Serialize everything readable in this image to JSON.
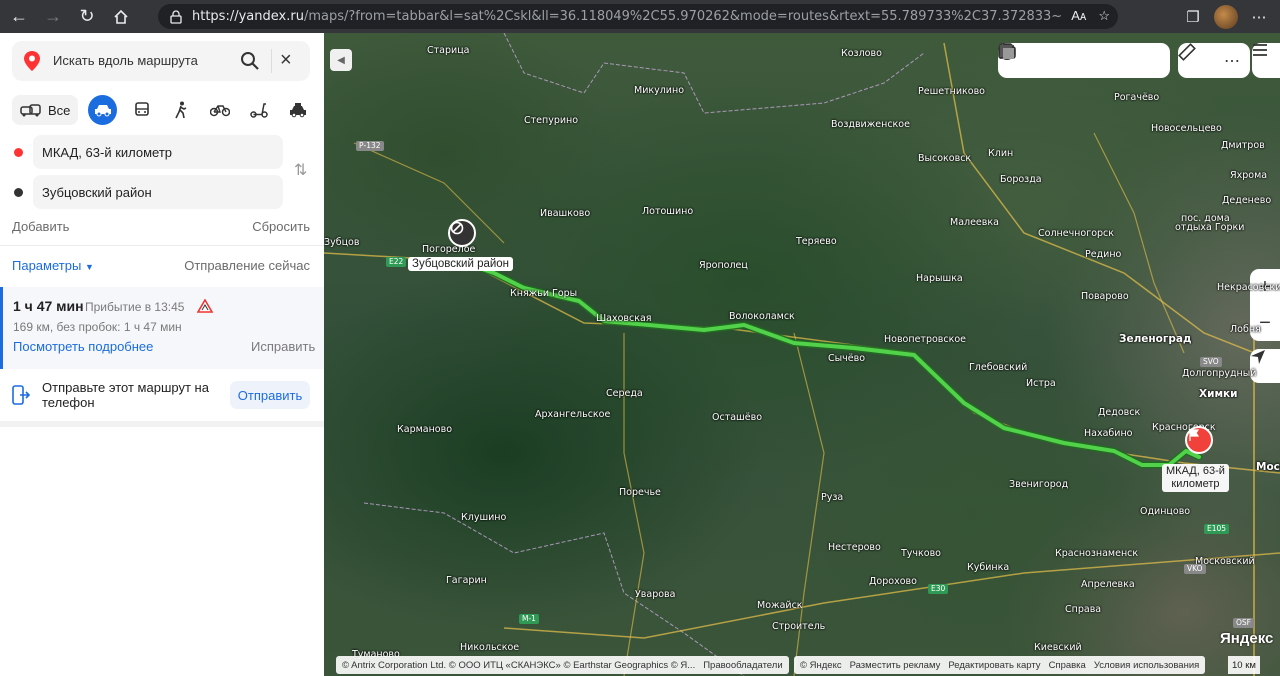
{
  "browser": {
    "url_host": "https://yandex.ru",
    "url_rest": "/maps/?from=tabbar&l=sat%2Cskl&ll=36.118049%2C55.970262&mode=routes&rtext=55.789733%2C37.372833~56.166988%2C34.985227&rtt=auto&ruri...",
    "reader_label": "Aᴀ"
  },
  "panel": {
    "search_placeholder": "Искать вдоль маршрута",
    "mode_all": "Все",
    "from_point": "МКАД, 63-й километр",
    "to_point": "Зубцовский район",
    "add_label": "Добавить",
    "reset_label": "Сбросить",
    "params_label": "Параметры",
    "departure_label": "Отправление сейчас",
    "route": {
      "duration": "1 ч 47 мин",
      "arrival": "Прибытие в 13:45",
      "distance": "169 км, без пробок: 1 ч 47 мин",
      "details_link": "Посмотреть подробнее",
      "fix_link": "Исправить"
    },
    "send": {
      "text": "Отправьте этот маршрут на телефон",
      "button": "Отправить"
    }
  },
  "map": {
    "start_label": "Зубцовский район",
    "end_label_1": "МКАД, 63-й",
    "end_label_2": "километр",
    "cities": [
      {
        "name": "Старица",
        "cls": ""
      },
      {
        "name": "Козлово",
        "cls": ""
      },
      {
        "name": "Микулино",
        "cls": ""
      },
      {
        "name": "Решетниково",
        "cls": ""
      },
      {
        "name": "Рогачёво",
        "cls": ""
      },
      {
        "name": "Степурино",
        "cls": ""
      },
      {
        "name": "Воздвиженское",
        "cls": ""
      },
      {
        "name": "Новосельцево",
        "cls": ""
      },
      {
        "name": "Высоковск",
        "cls": ""
      },
      {
        "name": "Клин",
        "cls": ""
      },
      {
        "name": "Дмитров",
        "cls": ""
      },
      {
        "name": "Борозда",
        "cls": ""
      },
      {
        "name": "Яхрома",
        "cls": ""
      },
      {
        "name": "Деденево",
        "cls": ""
      },
      {
        "name": "Ивашково",
        "cls": ""
      },
      {
        "name": "Лотошино",
        "cls": ""
      },
      {
        "name": "Малеевка",
        "cls": ""
      },
      {
        "name": "пос. дома",
        "cls": ""
      },
      {
        "name": "отдыха Горки",
        "cls": ""
      },
      {
        "name": "Солнечногорск",
        "cls": ""
      },
      {
        "name": "Зубцов",
        "cls": ""
      },
      {
        "name": "Погорелое",
        "cls": ""
      },
      {
        "name": "Теряево",
        "cls": ""
      },
      {
        "name": "Редино",
        "cls": ""
      },
      {
        "name": "Ярополец",
        "cls": ""
      },
      {
        "name": "Нарышка",
        "cls": ""
      },
      {
        "name": "Некрасовский",
        "cls": ""
      },
      {
        "name": "Княжьи Горы",
        "cls": ""
      },
      {
        "name": "Поварово",
        "cls": ""
      },
      {
        "name": "Лобня",
        "cls": ""
      },
      {
        "name": "Шаховская",
        "cls": ""
      },
      {
        "name": "Волоколамск",
        "cls": ""
      },
      {
        "name": "Новопетровское",
        "cls": ""
      },
      {
        "name": "Зеленоград",
        "cls": "big"
      },
      {
        "name": "Сычёво",
        "cls": ""
      },
      {
        "name": "Глебовский",
        "cls": ""
      },
      {
        "name": "Долгопрудный",
        "cls": ""
      },
      {
        "name": "Середа",
        "cls": ""
      },
      {
        "name": "Истра",
        "cls": ""
      },
      {
        "name": "Химки",
        "cls": "big"
      },
      {
        "name": "Архангельское",
        "cls": ""
      },
      {
        "name": "Осташёво",
        "cls": ""
      },
      {
        "name": "Дедовск",
        "cls": ""
      },
      {
        "name": "Карманово",
        "cls": ""
      },
      {
        "name": "Нахабино",
        "cls": ""
      },
      {
        "name": "Красногорск",
        "cls": ""
      },
      {
        "name": "Звенигород",
        "cls": ""
      },
      {
        "name": "Моск",
        "cls": "big"
      },
      {
        "name": "Поречье",
        "cls": ""
      },
      {
        "name": "Руза",
        "cls": ""
      },
      {
        "name": "Одинцово",
        "cls": ""
      },
      {
        "name": "Клушино",
        "cls": ""
      },
      {
        "name": "Нестерово",
        "cls": ""
      },
      {
        "name": "Тучково",
        "cls": ""
      },
      {
        "name": "Краснознаменск",
        "cls": ""
      },
      {
        "name": "Кубинка",
        "cls": ""
      },
      {
        "name": "Московский",
        "cls": ""
      },
      {
        "name": "Гагарин",
        "cls": ""
      },
      {
        "name": "Дорохово",
        "cls": ""
      },
      {
        "name": "Апрелевка",
        "cls": ""
      },
      {
        "name": "Уварова",
        "cls": ""
      },
      {
        "name": "Можайск",
        "cls": ""
      },
      {
        "name": "Справа",
        "cls": ""
      },
      {
        "name": "Строитель",
        "cls": ""
      },
      {
        "name": "Никольское",
        "cls": ""
      },
      {
        "name": "Туманово",
        "cls": ""
      },
      {
        "name": "Киевский",
        "cls": ""
      }
    ],
    "roads": [
      {
        "name": "Р-132",
        "cls": "grey"
      },
      {
        "name": "E22",
        "cls": ""
      },
      {
        "name": "E30",
        "cls": ""
      },
      {
        "name": "M-1",
        "cls": ""
      },
      {
        "name": "E105",
        "cls": ""
      },
      {
        "name": "SVO",
        "cls": "grey"
      },
      {
        "name": "VKO",
        "cls": "grey"
      },
      {
        "name": "OSF",
        "cls": "grey"
      }
    ],
    "footer_copyright": "© Antrix Corporation Ltd. © ООО ИТЦ «СКАНЭКС» © Earthstar Geographics © Я...",
    "footer_rights": "Правообладатели",
    "footer_items": [
      "© Яндекс",
      "Разместить рекламу",
      "Редактировать карту",
      "Справка",
      "Условия использования"
    ],
    "logo": "Яндекс",
    "scale": "10 км"
  }
}
